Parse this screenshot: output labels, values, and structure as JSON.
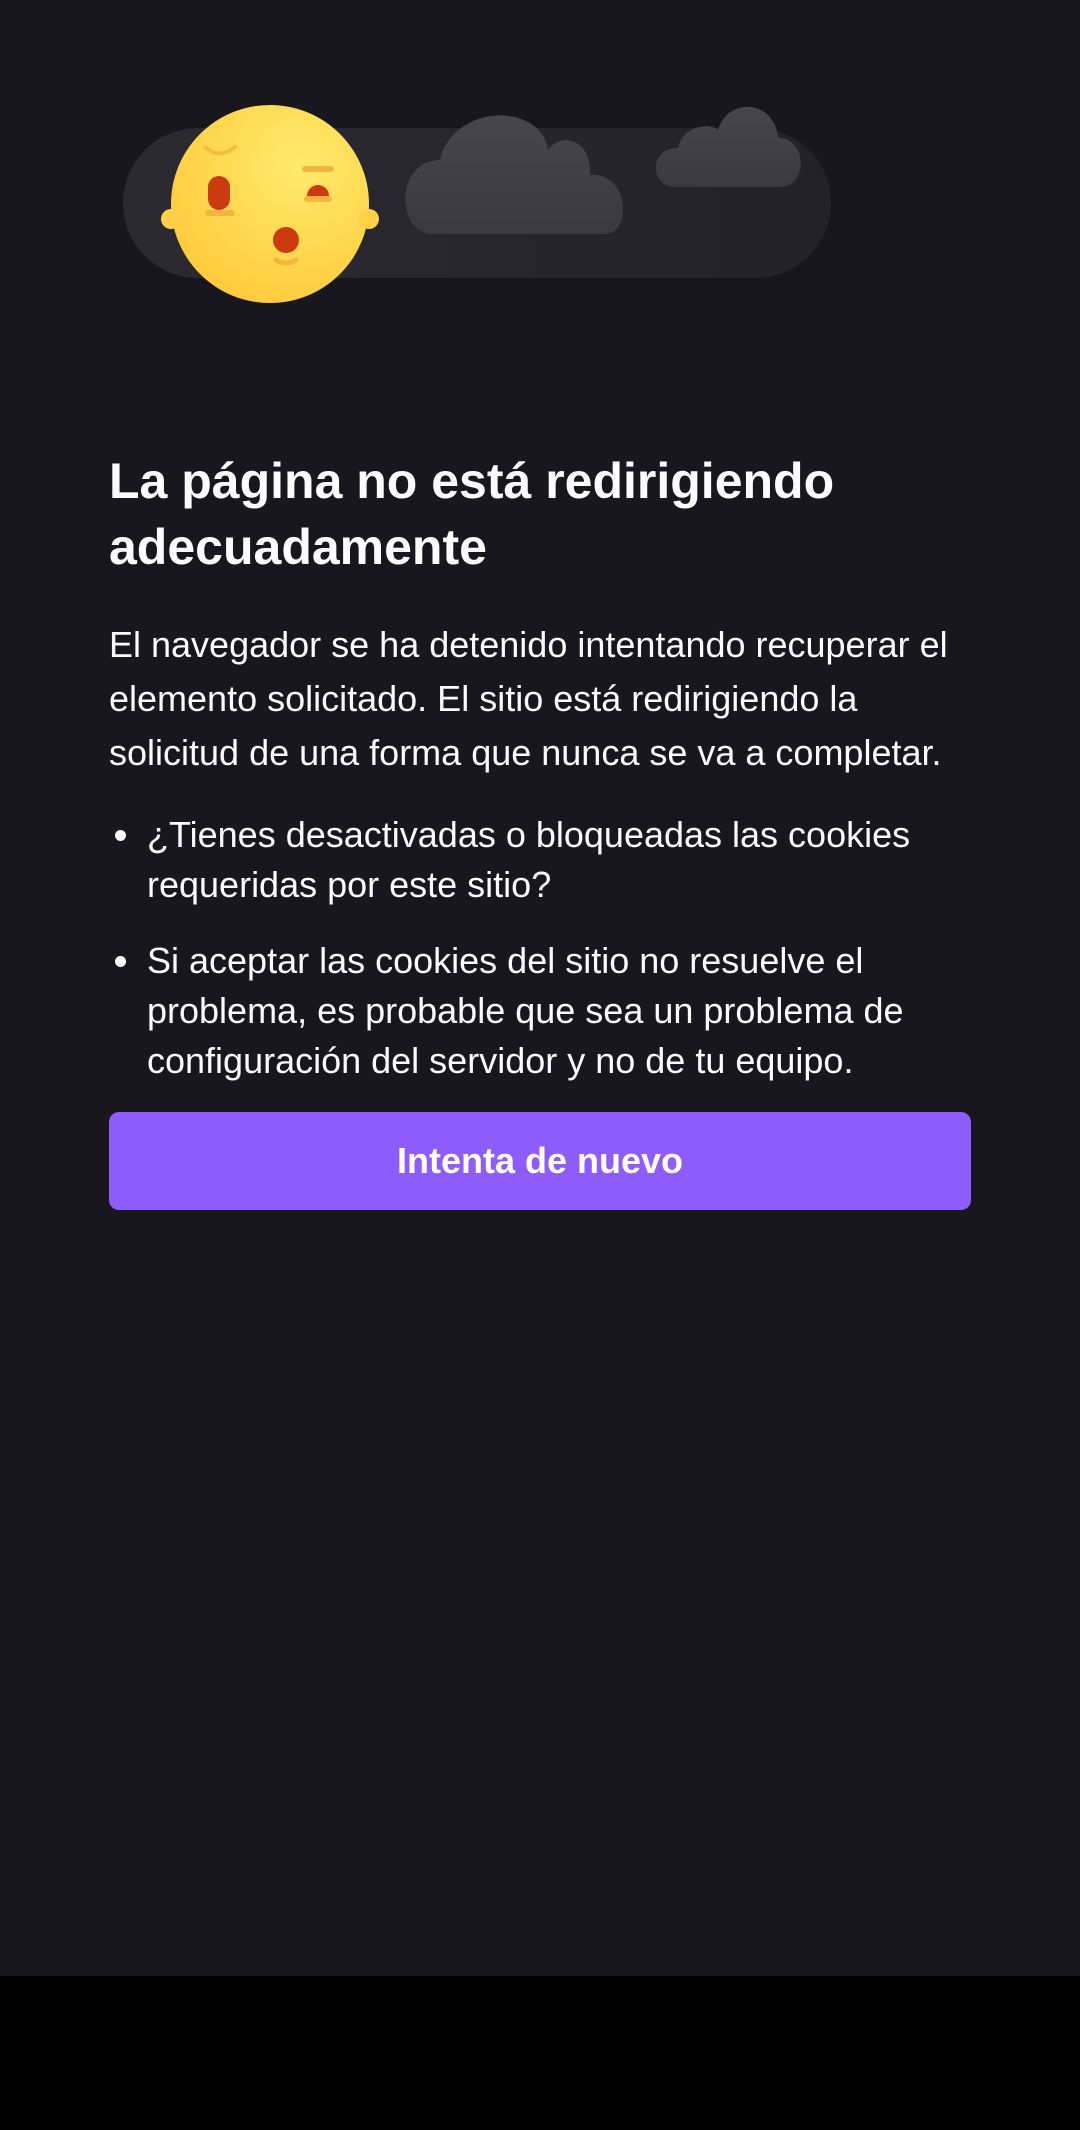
{
  "colors": {
    "background": "#18171e",
    "text": "#fbfbfe",
    "button": "#8f5cfc",
    "button_text": "#ffffff",
    "nav_bar": "#000000"
  },
  "illustration": {
    "icon": "sleepy-moon-clouds-icon"
  },
  "error": {
    "title": "La página no está redirigiendo adecuadamente",
    "intro": "El navegador se ha detenido intentando recuperar el elemento solicitado. El sitio está redirigiendo la solicitud de una forma que nunca se va a completar.",
    "bullets": [
      "¿Tienes desactivadas o bloqueadas las cookies requeridas por este sitio?",
      "Si aceptar las cookies del sitio no resuelve el problema, es probable que sea un problema de configuración del servidor y no de tu equipo."
    ],
    "retry_label": "Intenta de nuevo"
  }
}
